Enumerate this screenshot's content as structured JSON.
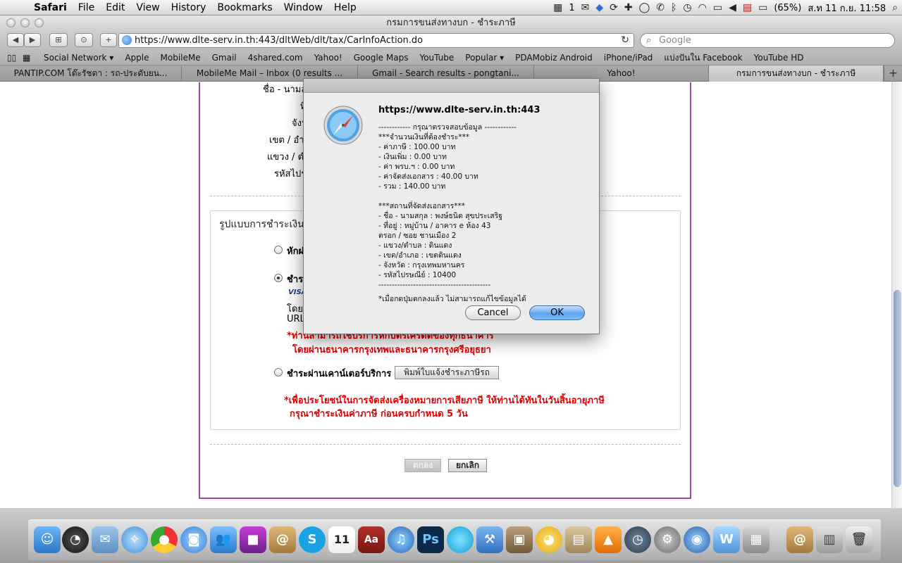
{
  "menubar": {
    "app": "Safari",
    "items": [
      "File",
      "Edit",
      "View",
      "History",
      "Bookmarks",
      "Window",
      "Help"
    ],
    "status_count": "1",
    "battery": "(65%)",
    "datetime": "ส.ท 11 ก.ย.  11:58"
  },
  "window": {
    "title": "กรมการขนส่งทางบก - ชำระภาษี"
  },
  "toolbar": {
    "url": "https://www.dlte-serv.in.th:443/dltWeb/dlt/tax/CarInfoAction.do",
    "search_placeholder": "Google"
  },
  "bookmarks": [
    "Social Network ▾",
    "Apple",
    "MobileMe",
    "Gmail",
    "4shared.com",
    "Yahoo!",
    "Google Maps",
    "YouTube",
    "Popular ▾",
    "PDAMobiz Android",
    "iPhone/iPad",
    "แบ่งปันใน Facebook",
    "YouTube HD"
  ],
  "tabs": [
    "PANTIP.COM โต๊ะรัชดา : รถ-ประดับยน...",
    "MobileMe Mail – Inbox (0 results ...",
    "Gmail - Search results - pongtani...",
    "Yahoo!",
    "กรมการขนส่งทางบก - ชำระภาษี"
  ],
  "page": {
    "labels": [
      "ชื่อ - นามส",
      "ที่",
      "จังห",
      "เขต / อำ",
      "แขวง / ตำ",
      "รหัสไปร"
    ],
    "payment_title": "รูปแบบการชำระเงิน",
    "option1": "หักผ่",
    "option2": "ชำระ",
    "visa": "VISA",
    "desc1": "โดยก",
    "desc2": "URL",
    "note1": "*ท่านสามารถใช้บริการหักบัตรเครดิตของทุกธนาคาร",
    "note2": "โดยผ่านธนาคารกรุงเทพและธนาคารกรุงศรีอยุธยา",
    "option3": "ชำระผ่านเคาน์เตอร์บริการ",
    "print_button": "พิมพ์ใบแจ้งชำระภาษีรถ",
    "note3": "*เพื่อประโยชน์ในการจัดส่งเครื่องหมายการเสียภาษี ให้ท่านได้ทันในวันสิ้นอายุภาษี",
    "note4": "กรุณาชำระเงินค่าภาษี ก่อนครบกำหนด 5 วัน",
    "confirm_button": "ตกลง",
    "cancel_button": "ยกเลิก"
  },
  "dialog": {
    "title": "https://www.dlte-serv.in.th:443",
    "lines": [
      "------------ กรุณาตรวจสอบข้อมูล ------------",
      "***จำนวนเงินที่ต้องชำระ***",
      " - ค่าภาษี : 100.00 บาท",
      " - เงินเพิ่ม : 0.00 บาท",
      " - ค่า พรบ.ฯ : 0.00 บาท",
      " - ค่าจัดส่งเอกสาร : 40.00 บาท",
      " - รวม : 140.00 บาท",
      "",
      "***สถานที่จัดส่งเอกสาร***",
      " - ชื่อ - นามสกุล : พงษ์ธนิต สุขประเสริฐ",
      " - ที่อยู่ :        หมู่บ้าน / อาคาร              e ห้อง 43",
      "ตรอก / ซอย ชานเมือง 2",
      " - แขวง/ตำบล : ดินแดง",
      " - เขต/อำเภอ : เขตดินแดง",
      " - จังหวัด : กรุงเทพมหานคร",
      " - รหัสไปรษณีย์ : 10400",
      "------------------------------------------",
      "",
      "*เมื่อกดปุ่มตกลงแล้ว ไม่สามารถแก้ไขข้อมูลได้"
    ],
    "cancel": "Cancel",
    "ok": "OK"
  },
  "dock": {
    "icons": [
      "finder-icon",
      "dashboard-icon",
      "mail-icon",
      "safari-icon",
      "chrome-icon",
      "facetime-icon",
      "contacts-icon",
      "app-icon",
      "address-book-icon",
      "skype-icon",
      "ical-icon",
      "dictionary-icon",
      "itunes-icon",
      "photoshop-icon",
      "app-icon",
      "xcode-icon",
      "iphoto-icon",
      "adium-icon",
      "preview-icon",
      "vlc-icon",
      "time-machine-icon",
      "system-preferences-icon",
      "app-icon",
      "app-icon",
      "app-icon",
      "documents-icon",
      "downloads-icon",
      "trash-icon"
    ],
    "ical_day": "11",
    "ps_label": "Ps",
    "dict_label": "Aa"
  }
}
